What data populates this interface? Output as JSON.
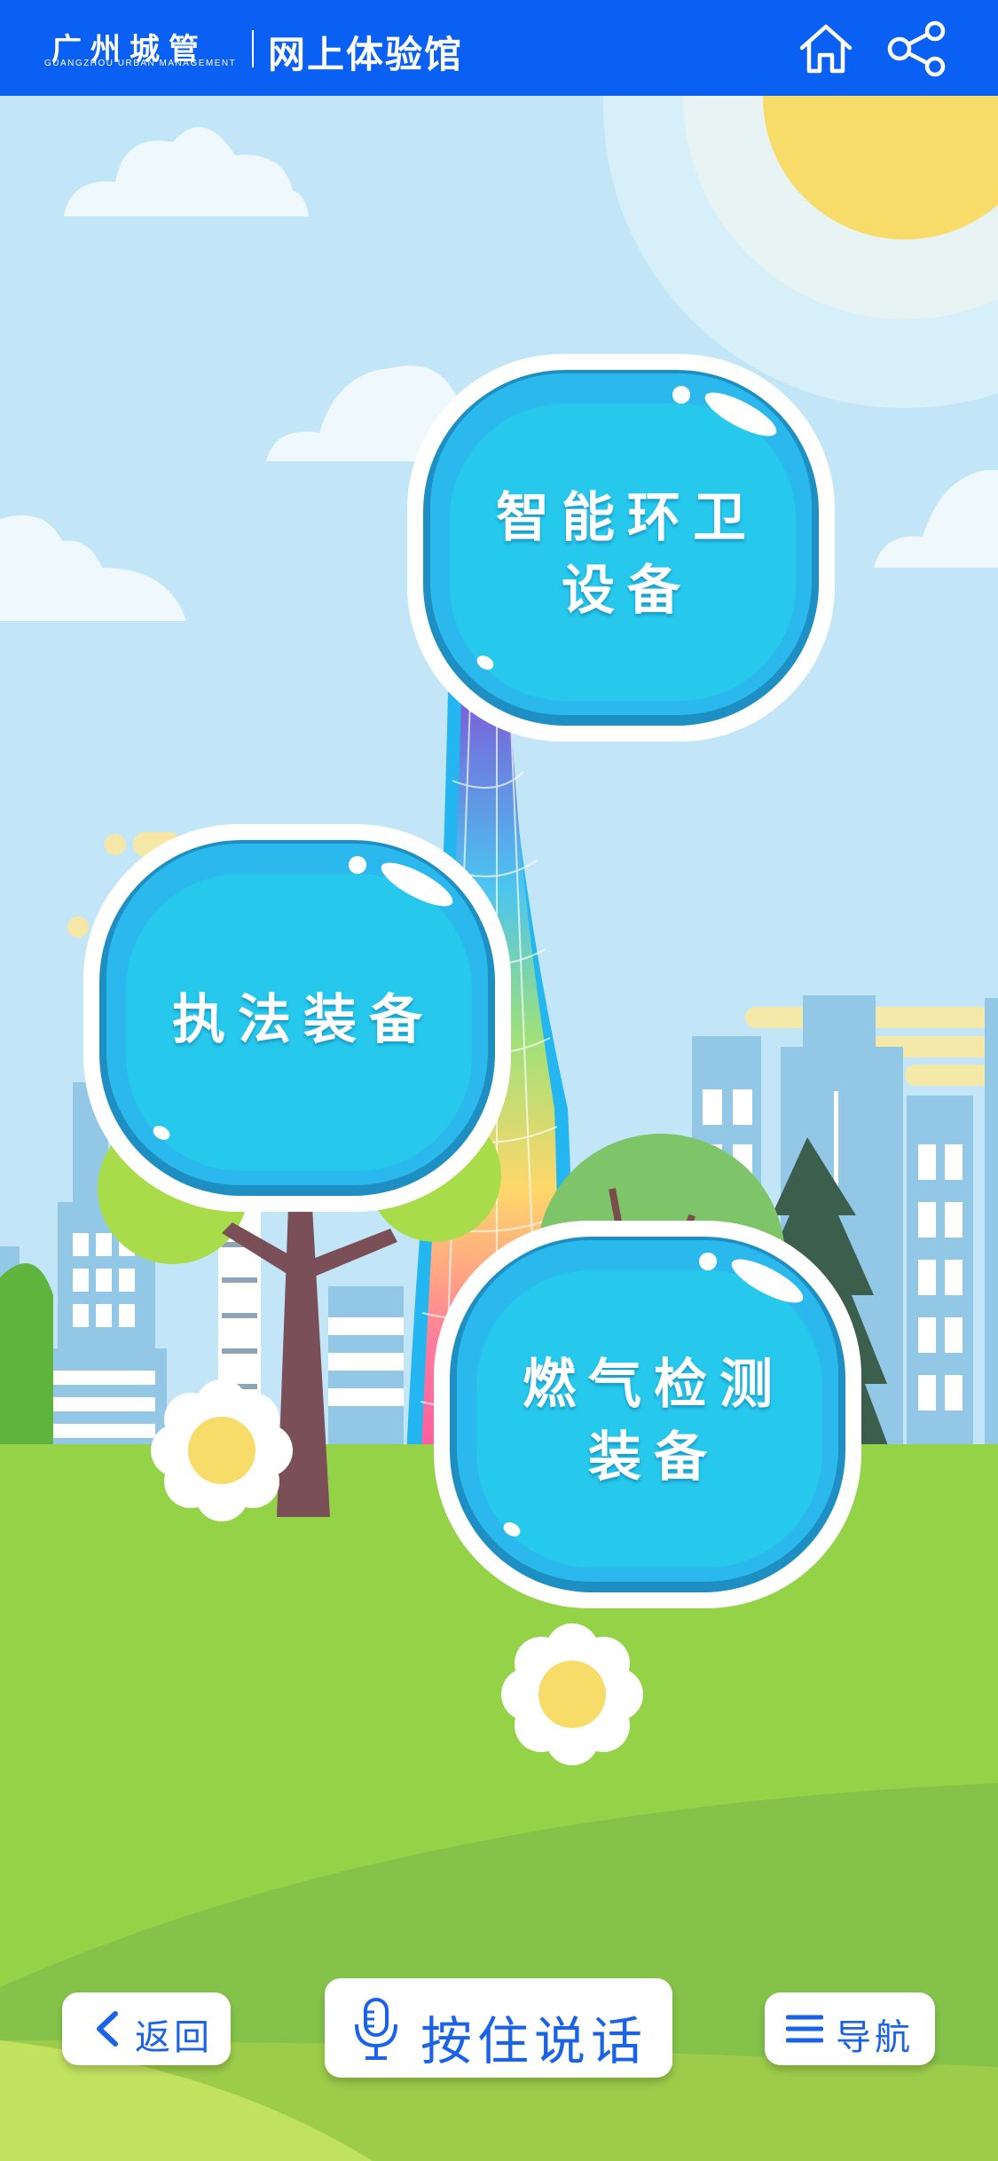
{
  "header": {
    "logo_cn": "广州城管",
    "logo_en": "GUANGZHOU URBAN MANAGEMENT",
    "title": "网上体验馆",
    "home_icon": "home-icon",
    "share_icon": "share-icon"
  },
  "categories": [
    {
      "line1": "智能环卫",
      "line2": "设备"
    },
    {
      "line1": "执法装备",
      "line2": ""
    },
    {
      "line1": "燃气检测",
      "line2": "装备"
    }
  ],
  "footer": {
    "back_label": "返回",
    "back_icon": "chevron-left-icon",
    "talk_label": "按住说话",
    "talk_icon": "microphone-icon",
    "nav_label": "导航",
    "nav_icon": "menu-icon"
  },
  "colors": {
    "header_bg": "#0a60f2",
    "sky": "#c2e6f7",
    "grass": "#93d24a",
    "bubble": "#29b6ea",
    "button_text": "#1a62e8"
  }
}
